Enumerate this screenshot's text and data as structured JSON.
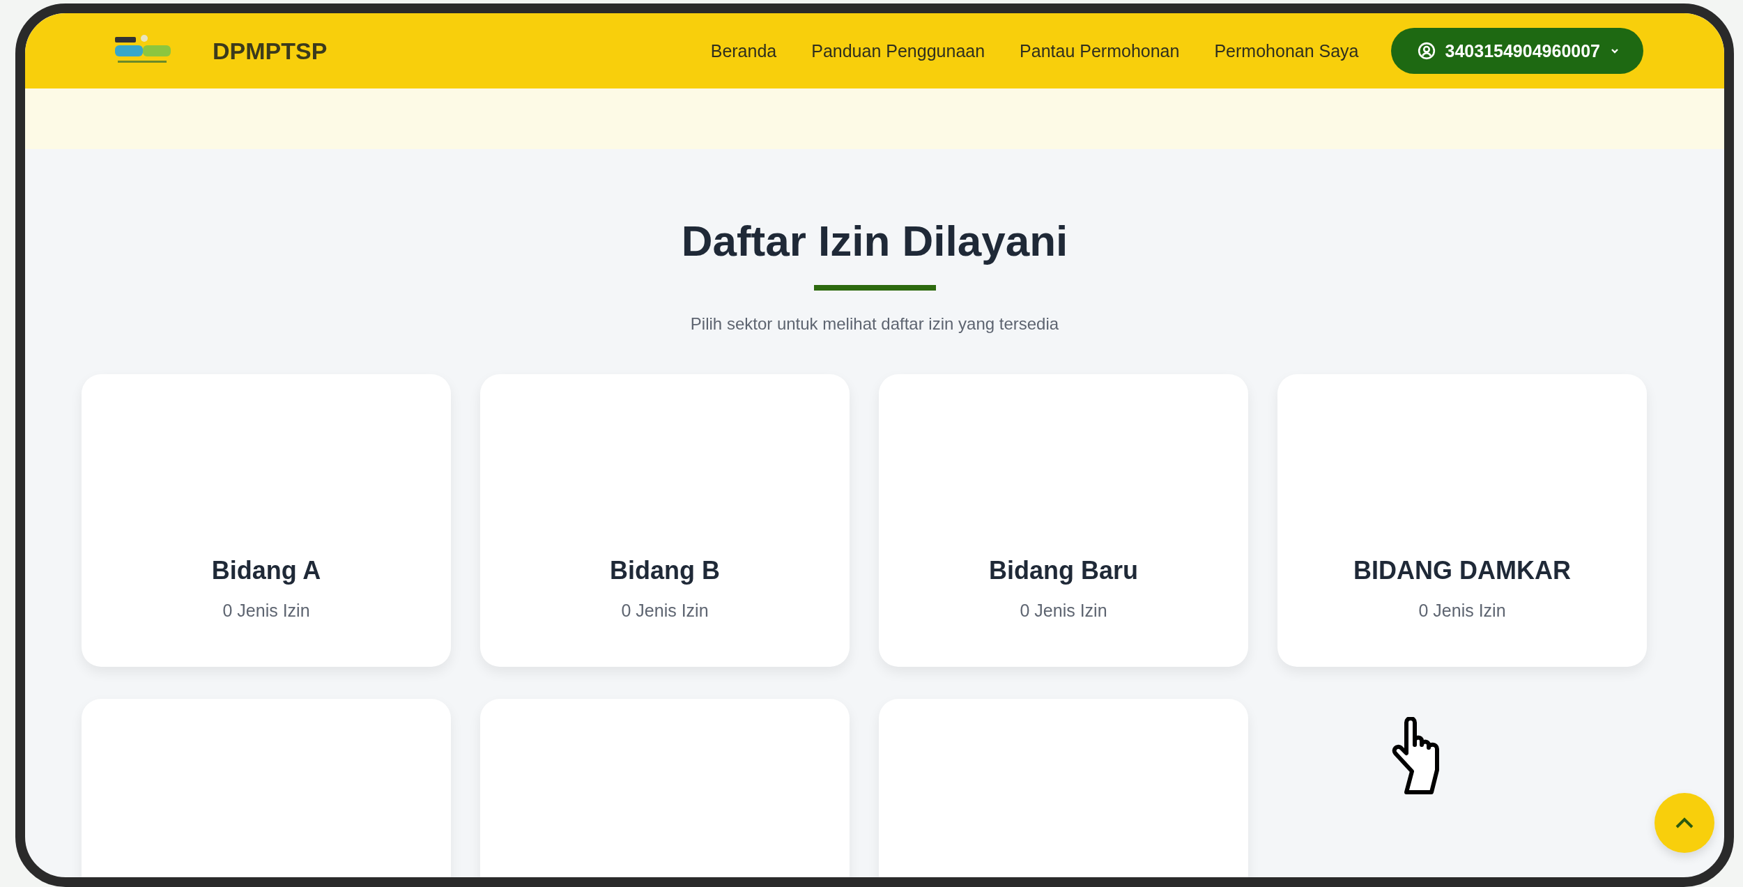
{
  "header": {
    "brand": "DPMPTSP",
    "nav": [
      {
        "label": "Beranda"
      },
      {
        "label": "Panduan Penggunaan"
      },
      {
        "label": "Pantau Permohonan"
      },
      {
        "label": "Permohonan Saya"
      }
    ],
    "account": "3403154904960007"
  },
  "section": {
    "title": "Daftar Izin Dilayani",
    "subtitle": "Pilih sektor untuk melihat daftar izin yang tersedia"
  },
  "cards": [
    {
      "kind": "sector",
      "title": "Bidang A",
      "count": "0 Jenis Izin"
    },
    {
      "kind": "sector",
      "title": "Bidang B",
      "count": "0 Jenis Izin"
    },
    {
      "kind": "sector",
      "title": "Bidang Baru",
      "count": "0 Jenis Izin"
    },
    {
      "kind": "sector",
      "title": "BIDANG DAMKAR",
      "count": "0 Jenis Izin"
    },
    {
      "kind": "empty"
    },
    {
      "kind": "empty"
    },
    {
      "kind": "empty"
    }
  ]
}
